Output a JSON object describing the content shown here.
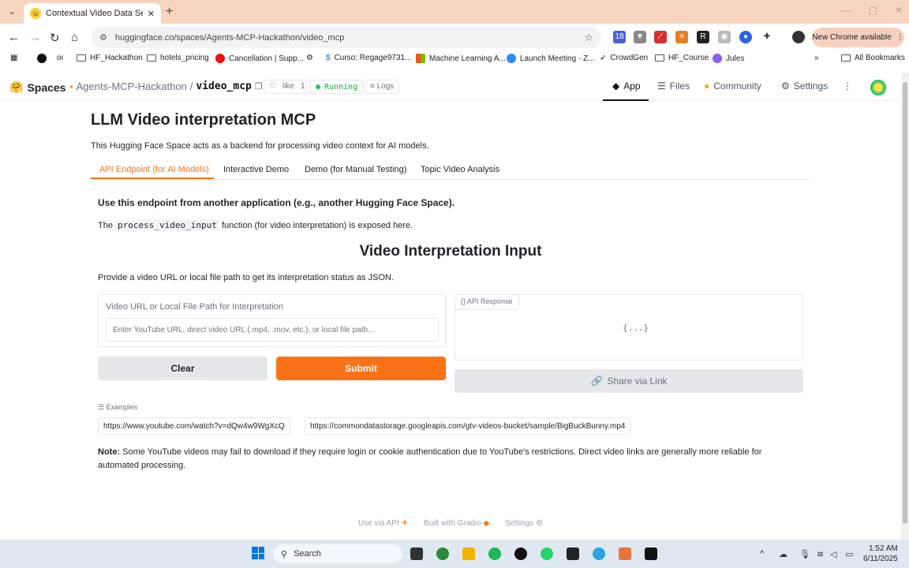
{
  "browser": {
    "tab_title": "Contextual Video Data Server (I",
    "tab_close": "✕",
    "new_tab": "+",
    "url": "huggingface.co/spaces/Agents-MCP-Hackathon/video_mcp",
    "new_chrome": "New Chrome available",
    "bookmarks": [
      {
        "label": "HF_Hackathon",
        "icon": "folder-icon"
      },
      {
        "label": "hotels_pricing",
        "icon": "folder-icon"
      },
      {
        "label": "Cancellation | Supp...",
        "icon": "site-icon"
      },
      {
        "label": "Curso: Regage9731...",
        "icon": "site-icon"
      },
      {
        "label": "Machine Learning A...",
        "icon": "site-icon"
      },
      {
        "label": "Launch Meeting - Z...",
        "icon": "site-icon"
      },
      {
        "label": "CrowdGen",
        "icon": "site-icon"
      },
      {
        "label": "HF_Course",
        "icon": "folder-icon"
      },
      {
        "label": "Jules",
        "icon": "site-icon"
      }
    ],
    "all_bookmarks": "All Bookmarks",
    "ext_badge": "18"
  },
  "hf": {
    "logo": "Spaces",
    "org": "Agents-MCP-Hackathon",
    "separator": "/",
    "space": "video_mcp",
    "like_label": "like",
    "like_count": "1",
    "status": "Running",
    "logs": "Logs",
    "tabs": {
      "app": "App",
      "files": "Files",
      "community": "Community",
      "settings": "Settings"
    }
  },
  "main": {
    "title": "LLM Video interpretation MCP",
    "description": "This Hugging Face Space acts as a backend for processing video context for AI models.",
    "tabs": [
      "API Endpoint (for AI Models)",
      "Interactive Demo",
      "Demo (for Manual Testing)",
      "Topic Video Analysis"
    ],
    "endpoint_heading": "Use this endpoint from another application (e.g., another Hugging Face Space).",
    "fn_prefix": "The",
    "fn_name": "process_video_input",
    "fn_suffix": "function (for video interpretation) is exposed here.",
    "section_title": "Video Interpretation Input",
    "provide_text": "Provide a video URL or local file path to get its interpretation status as JSON.",
    "input_label": "Video URL or Local File Path for Interpretation",
    "input_placeholder": "Enter YouTube URL, direct video URL (.mp4, .mov, etc.), or local file path...",
    "api_response_label": "API Response",
    "api_response_value": "{...}",
    "clear_label": "Clear",
    "submit_label": "Submit",
    "share_label": "Share via Link",
    "examples_label": "Examples",
    "examples": [
      "https://www.youtube.com/watch?v=dQw4w9WgXcQ",
      "https://commondatastorage.googleapis.com/gtv-videos-bucket/sample/BigBuckBunny.mp4"
    ],
    "note_label": "Note:",
    "note_text": "Some YouTube videos may fail to download if they require login or cookie authentication due to YouTube's restrictions. Direct video links are generally more reliable for automated processing.",
    "footer": {
      "api": "Use via API",
      "built": "Built with Gradio",
      "settings": "Settings"
    }
  },
  "taskbar": {
    "search": "Search",
    "time": "1:52 AM",
    "date": "6/11/2025"
  },
  "colors": {
    "accent": "#f97316",
    "running": "#16a34a",
    "tabbar": "#f7d4c0"
  }
}
